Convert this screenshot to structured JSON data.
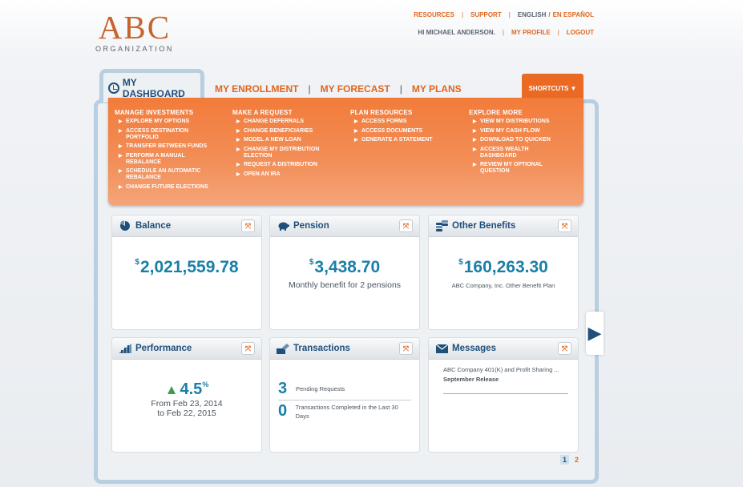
{
  "logo": {
    "main": "ABC",
    "sub": "ORGANIZATION"
  },
  "toplinks": {
    "resources": "RESOURCES",
    "support": "SUPPORT",
    "english": "ENGLISH",
    "espanol": "EN ESPAÑOL",
    "greeting": "HI MICHAEL ANDERSON.",
    "my_profile": "MY PROFILE",
    "logout": "LOGOUT"
  },
  "tabs": {
    "active": "MY DASHBOARD",
    "items": [
      "MY ENROLLMENT",
      "MY FORECAST",
      "MY PLANS"
    ],
    "shortcuts": "SHORTCUTS ▼"
  },
  "menu": {
    "columns": [
      {
        "title": "MANAGE INVESTMENTS",
        "items": [
          "EXPLORE MY OPTIONS",
          "ACCESS DESTINATION PORTFOLIO",
          "TRANSFER BETWEEN FUNDS",
          "PERFORM A MANUAL REBALANCE",
          "SCHEDULE AN AUTOMATIC REBALANCE",
          "CHANGE FUTURE ELECTIONS"
        ]
      },
      {
        "title": "MAKE A REQUEST",
        "items": [
          "CHANGE DEFERRALS",
          "CHANGE BENEFICIARIES",
          "MODEL A NEW LOAN",
          "CHANGE MY DISTRIBUTION ELECTION",
          "REQUEST A DISTRIBUTION",
          "OPEN AN IRA"
        ]
      },
      {
        "title": "PLAN RESOURCES",
        "items": [
          "ACCESS FORMS",
          "ACCESS DOCUMENTS",
          "GENERATE A STATEMENT"
        ]
      },
      {
        "title": "EXPLORE MORE",
        "items": [
          "VIEW MY DISTRIBUTIONS",
          "VIEW MY CASH FLOW",
          "DOWNLOAD TO QUICKEN",
          "ACCESS WEALTH DASHBOARD",
          "REVIEW MY OPTIONAL QUESTION"
        ]
      }
    ]
  },
  "cards": {
    "balance": {
      "title": "Balance",
      "currency": "$",
      "amount": "2,021,559.78"
    },
    "pension": {
      "title": "Pension",
      "currency": "$",
      "amount": "3,438.70",
      "subtitle": "Monthly benefit for 2 pensions"
    },
    "other": {
      "title": "Other Benefits",
      "currency": "$",
      "amount": "160,263.30",
      "subtitle": "ABC Company, Inc. Other Benefit Plan"
    },
    "performance": {
      "title": "Performance",
      "value": "4.5",
      "unit": "%",
      "from": "From Feb 23, 2014",
      "to": "to Feb 22, 2015"
    },
    "transactions": {
      "title": "Transactions",
      "pending_count": "3",
      "pending_label": "Pending Requests",
      "completed_count": "0",
      "completed_label": "Transactions Completed in the Last 30 Days"
    },
    "messages": {
      "title": "Messages",
      "line1": "ABC Company 401(K) and Profit Sharing ...",
      "line2": "September Release"
    }
  },
  "pager": {
    "page1": "1",
    "page2": "2"
  },
  "colors": {
    "accent": "#e0661f",
    "navy": "#1f4f7a",
    "teal": "#1a7fa8",
    "frame": "#b7cfe0"
  }
}
